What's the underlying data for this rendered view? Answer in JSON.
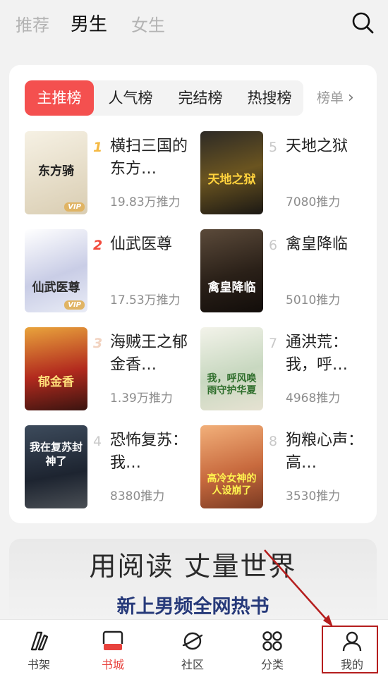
{
  "top_tabs": [
    "推荐",
    "男生",
    "女生"
  ],
  "rank_tabs": [
    "主推榜",
    "人气榜",
    "完结榜",
    "热搜榜"
  ],
  "rank_more": "榜单",
  "books": [
    {
      "rank": "1",
      "title": "横扫三国的东方…",
      "pop": "19.83万推力",
      "cover_title": "东方骑",
      "vip": "VIP"
    },
    {
      "rank": "2",
      "title": "仙武医尊",
      "pop": "17.53万推力",
      "cover_title": "仙武医尊",
      "vip": "VIP"
    },
    {
      "rank": "3",
      "title": "海贼王之郁金香…",
      "pop": "1.39万推力",
      "cover_title": "郁金香"
    },
    {
      "rank": "4",
      "title": "恐怖复苏：我…",
      "pop": "8380推力",
      "cover_title": "我在复苏封神了"
    },
    {
      "rank": "5",
      "title": "天地之狱",
      "pop": "7080推力",
      "cover_title": "天地之狱"
    },
    {
      "rank": "6",
      "title": "禽皇降临",
      "pop": "5010推力",
      "cover_title": "禽皇降临"
    },
    {
      "rank": "7",
      "title": "通洪荒：我，呼…",
      "pop": "4968推力",
      "cover_title": "我，呼风唤雨守护华夏"
    },
    {
      "rank": "8",
      "title": "狗粮心声：高…",
      "pop": "3530推力",
      "cover_title": "高冷女神的人设崩了"
    }
  ],
  "banner": {
    "slogan": "用阅读 丈量世界",
    "sub": "新上男频全网热书"
  },
  "nav": [
    "书架",
    "书城",
    "社区",
    "分类",
    "我的"
  ],
  "colors": {
    "accent": "#f4504f",
    "nav_active": "#e8423d",
    "highlight_box": "#b51e1e"
  }
}
